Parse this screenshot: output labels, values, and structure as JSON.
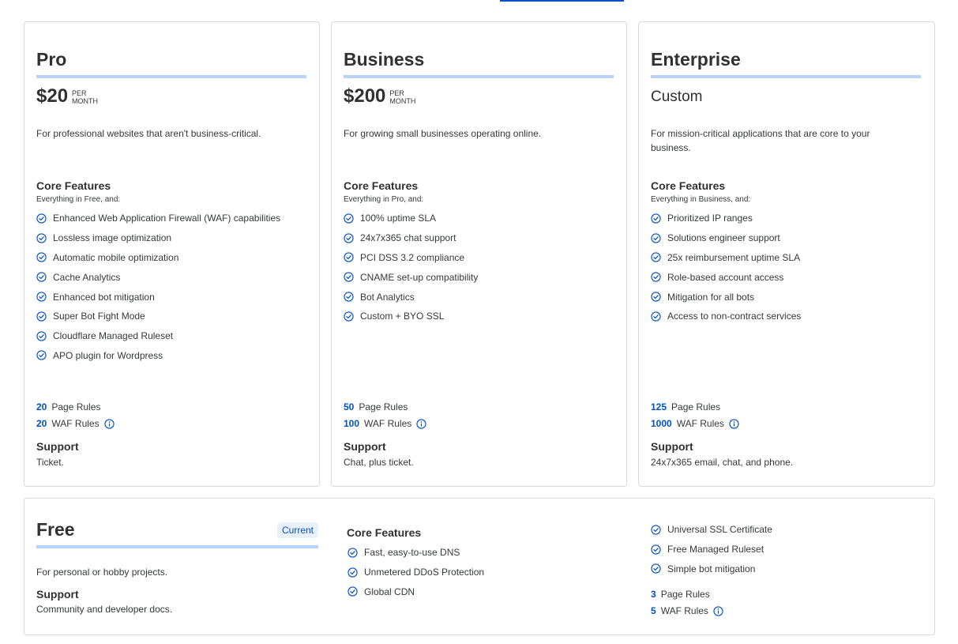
{
  "plans": [
    {
      "name": "Pro",
      "price": "$20",
      "price_unit_line1": "PER",
      "price_unit_line2": "MONTH",
      "description": "For professional websites that aren't business-critical.",
      "core_title": "Core Features",
      "core_subtitle": "Everything in Free, and:",
      "features": [
        "Enhanced Web Application Firewall (WAF) capabilities",
        "Lossless image optimization",
        "Automatic mobile optimization",
        "Cache Analytics",
        "Enhanced bot mitigation",
        "Super Bot Fight Mode",
        "Cloudflare Managed Ruleset",
        "APO plugin for Wordpress"
      ],
      "page_rules_count": "20",
      "page_rules_label": "Page Rules",
      "waf_rules_count": "20",
      "waf_rules_label": "WAF Rules",
      "support_title": "Support",
      "support_text": "Ticket."
    },
    {
      "name": "Business",
      "price": "$200",
      "price_unit_line1": "PER",
      "price_unit_line2": "MONTH",
      "description": "For growing small businesses operating online.",
      "core_title": "Core Features",
      "core_subtitle": "Everything in Pro, and:",
      "features": [
        "100% uptime SLA",
        "24x7x365 chat support",
        "PCI DSS 3.2 compliance",
        "CNAME set-up compatibility",
        "Bot Analytics",
        "Custom + BYO SSL"
      ],
      "page_rules_count": "50",
      "page_rules_label": "Page Rules",
      "waf_rules_count": "100",
      "waf_rules_label": "WAF Rules",
      "support_title": "Support",
      "support_text": "Chat, plus ticket."
    },
    {
      "name": "Enterprise",
      "price_custom": "Custom",
      "description_line1": "For mission-critical applications that are core to your",
      "description_line2": "business.",
      "core_title": "Core Features",
      "core_subtitle": "Everything in Business, and:",
      "features": [
        "Prioritized IP ranges",
        "Solutions engineer support",
        "25x reimbursement uptime SLA",
        "Role-based account access",
        "Mitigation for all bots",
        "Access to non-contract services"
      ],
      "page_rules_count": "125",
      "page_rules_label": "Page Rules",
      "waf_rules_count": "1000",
      "waf_rules_label": "WAF Rules",
      "support_title": "Support",
      "support_text": "24x7x365 email, chat, and phone."
    }
  ],
  "free": {
    "name": "Free",
    "badge": "Current",
    "description": "For personal or hobby projects.",
    "support_title": "Support",
    "support_text": "Community and developer docs.",
    "core_title": "Core Features",
    "features_left": [
      "Fast, easy-to-use DNS",
      "Unmetered DDoS Protection",
      "Global CDN"
    ],
    "features_right": [
      "Universal SSL Certificate",
      "Free Managed Ruleset",
      "Simple bot mitigation"
    ],
    "page_rules_count": "3",
    "page_rules_label": "Page Rules",
    "waf_rules_count": "5",
    "waf_rules_label": "WAF Rules"
  },
  "icons": {
    "check": "check-circle-icon",
    "info": "info-circle-icon"
  },
  "colors": {
    "accent": "#0051c3",
    "underline": "#b7d3f7",
    "border": "#d9d9d9"
  }
}
